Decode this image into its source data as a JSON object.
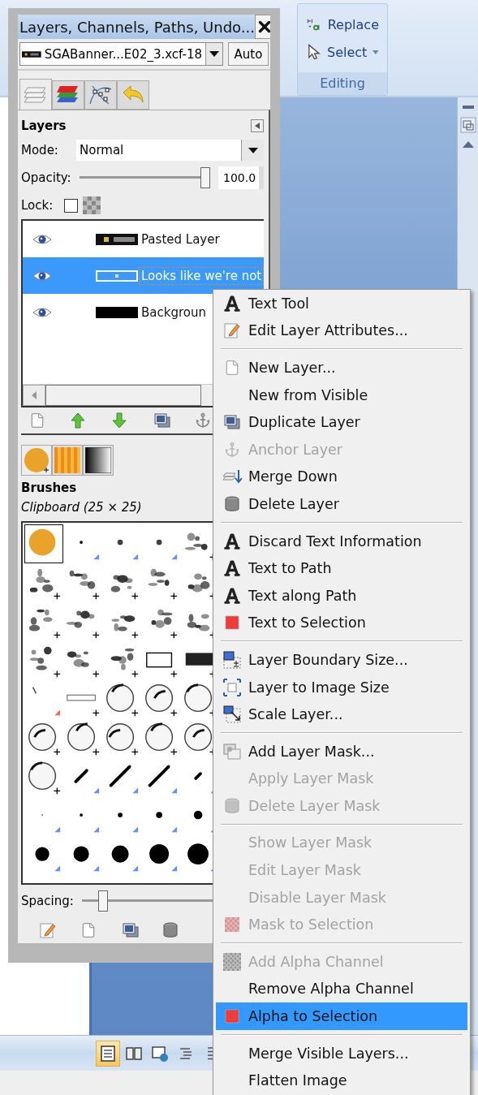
{
  "word": {
    "editing_group": {
      "buttons": [
        {
          "label": "Replace",
          "kind": "replace"
        },
        {
          "label": "Select",
          "kind": "select"
        }
      ],
      "label": "Editing"
    },
    "view_buttons": [
      {
        "kind": "print",
        "selected": true
      },
      {
        "kind": "reading",
        "selected": false
      },
      {
        "kind": "web",
        "selected": false
      },
      {
        "kind": "outline",
        "selected": false
      },
      {
        "kind": "draft",
        "selected": false
      }
    ]
  },
  "dock": {
    "title": "Layers, Channels, Paths, Undo...",
    "image": {
      "name": "SGABanner...E02_3.xcf-18",
      "auto": "Auto"
    },
    "tabs": [
      {
        "kind": "layers",
        "selected": true
      },
      {
        "kind": "channels",
        "selected": false
      },
      {
        "kind": "paths",
        "selected": false
      },
      {
        "kind": "undo",
        "selected": false
      }
    ],
    "layers_panel": {
      "title": "Layers",
      "mode": {
        "label": "Mode:",
        "value": "Normal"
      },
      "opacity": {
        "label": "Opacity:",
        "value": "100.0",
        "level": 1
      },
      "lock": {
        "label": "Lock:",
        "checked": false
      },
      "layers": [
        {
          "name": "Pasted Layer",
          "kind": "pasted",
          "visible": true,
          "selected": false
        },
        {
          "name": "Looks like we're not",
          "kind": "text",
          "visible": true,
          "selected": true
        },
        {
          "name": "Backgroun",
          "kind": "fill",
          "visible": true,
          "selected": false
        }
      ]
    },
    "resource_tabs": [
      {
        "kind": "brush",
        "selected": true
      },
      {
        "kind": "pattern",
        "selected": false
      },
      {
        "kind": "gradient",
        "selected": false
      }
    ],
    "brushes_panel": {
      "title": "Brushes",
      "current": "Clipboard (25 × 25)",
      "spacing": {
        "label": "Spacing:",
        "level": 0.1
      }
    }
  },
  "context_menu": {
    "sections": [
      [
        {
          "label": "Text Tool",
          "kind": "text",
          "disabled": false,
          "selected": false
        },
        {
          "label": "Edit Layer Attributes...",
          "kind": "edit",
          "disabled": false,
          "selected": false
        }
      ],
      [
        {
          "label": "New Layer...",
          "kind": "page",
          "disabled": false,
          "selected": false
        },
        {
          "label": "New from Visible",
          "kind": "none",
          "disabled": false,
          "selected": false
        },
        {
          "label": "Duplicate Layer",
          "kind": "duplicate",
          "disabled": false,
          "selected": false
        },
        {
          "label": "Anchor Layer",
          "kind": "anchor",
          "disabled": true,
          "selected": false
        },
        {
          "label": "Merge Down",
          "kind": "merge",
          "disabled": false,
          "selected": false
        },
        {
          "label": "Delete Layer",
          "kind": "trash",
          "disabled": false,
          "selected": false
        }
      ],
      [
        {
          "label": "Discard Text Information",
          "kind": "text",
          "disabled": false,
          "selected": false
        },
        {
          "label": "Text to Path",
          "kind": "text",
          "disabled": false,
          "selected": false
        },
        {
          "label": "Text along Path",
          "kind": "text",
          "disabled": false,
          "selected": false
        },
        {
          "label": "Text to Selection",
          "kind": "selection",
          "disabled": false,
          "selected": false
        }
      ],
      [
        {
          "label": "Layer Boundary Size...",
          "kind": "boundary",
          "disabled": false,
          "selected": false
        },
        {
          "label": "Layer to Image Size",
          "kind": "resize",
          "disabled": false,
          "selected": false
        },
        {
          "label": "Scale Layer...",
          "kind": "scale",
          "disabled": false,
          "selected": false
        }
      ],
      [
        {
          "label": "Add Layer Mask...",
          "kind": "mask",
          "disabled": false,
          "selected": false
        },
        {
          "label": "Apply Layer Mask",
          "kind": "none",
          "disabled": true,
          "selected": false
        },
        {
          "label": "Delete Layer Mask",
          "kind": "trash",
          "disabled": true,
          "selected": false
        }
      ],
      [
        {
          "label": "Show Layer Mask",
          "kind": "none",
          "disabled": true,
          "selected": false
        },
        {
          "label": "Edit Layer Mask",
          "kind": "none",
          "disabled": true,
          "selected": false
        },
        {
          "label": "Disable Layer Mask",
          "kind": "none",
          "disabled": true,
          "selected": false
        },
        {
          "label": "Mask to Selection",
          "kind": "masksel",
          "disabled": true,
          "selected": false
        }
      ],
      [
        {
          "label": "Add Alpha Channel",
          "kind": "checker",
          "disabled": true,
          "selected": false
        },
        {
          "label": "Remove Alpha Channel",
          "kind": "none",
          "disabled": false,
          "selected": false
        },
        {
          "label": "Alpha to Selection",
          "kind": "selection",
          "disabled": false,
          "selected": true
        }
      ],
      [
        {
          "label": "Merge Visible Layers...",
          "kind": "none",
          "disabled": false,
          "selected": false
        },
        {
          "label": "Flatten Image",
          "kind": "none",
          "disabled": false,
          "selected": false
        }
      ]
    ]
  }
}
